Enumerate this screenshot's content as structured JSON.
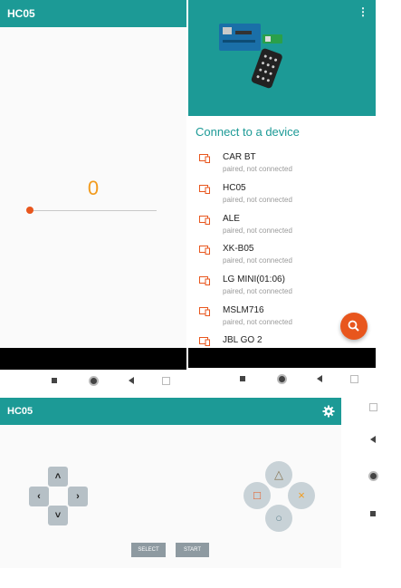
{
  "screen1": {
    "title": "HC05",
    "slider_value": "0",
    "slider_level": 0
  },
  "screen2": {
    "menu_icon": "more-vert-icon",
    "heading": "Connect to a device",
    "devices": [
      {
        "name": "CAR BT",
        "status": "paired, not connected"
      },
      {
        "name": "HC05",
        "status": "paired, not connected"
      },
      {
        "name": "ALE",
        "status": "paired, not connected"
      },
      {
        "name": "XK-B05",
        "status": "paired, not connected"
      },
      {
        "name": "LG MINI(01:06)",
        "status": "paired, not connected"
      },
      {
        "name": "MSLM716",
        "status": "paired, not connected"
      },
      {
        "name": "JBL GO 2",
        "status": ""
      }
    ],
    "fab_icon": "search-icon"
  },
  "screen3": {
    "title": "HC05",
    "settings_icon": "gear-icon",
    "dpad": {
      "up": "˄",
      "down": "˅",
      "left": "‹",
      "right": "›"
    },
    "buttons": {
      "triangle": "△",
      "square": "□",
      "cross": "×",
      "circle": "○"
    },
    "select_label": "SELECT",
    "start_label": "START"
  },
  "colors": {
    "teal": "#1c9a96",
    "orange": "#e8561d",
    "value_orange": "#f29b1d"
  }
}
